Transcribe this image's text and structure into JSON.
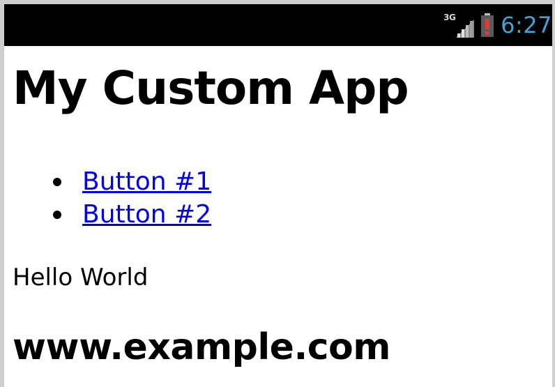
{
  "status_bar": {
    "network_type": "3G",
    "time": "6:27",
    "signal_icon": "signal-bars-icon",
    "battery_icon": "battery-alert-icon",
    "time_color": "#3ba4d8"
  },
  "page": {
    "title": "My Custom App",
    "nav_items": [
      {
        "label": "Button #1"
      },
      {
        "label": "Button #2"
      }
    ],
    "body_text": "Hello World",
    "footer_heading": "www.example.com"
  },
  "colors": {
    "link": "#0000ee",
    "battery_alert": "#e53935"
  }
}
